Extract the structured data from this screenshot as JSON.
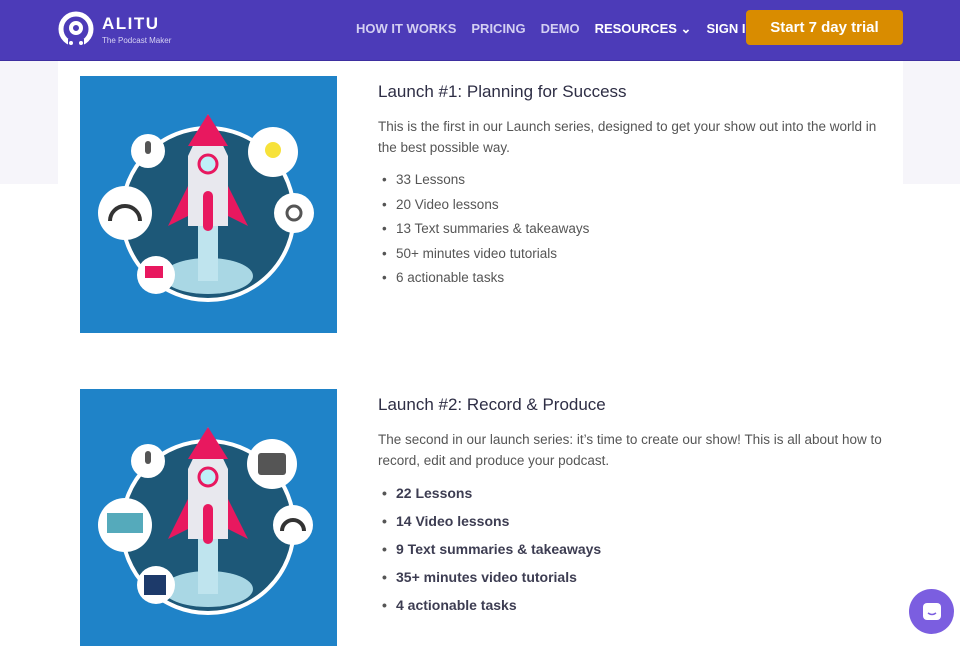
{
  "header": {
    "brand": "ALITU",
    "tagline": "The Podcast Maker",
    "nav": [
      "HOW IT WORKS",
      "PRICING",
      "DEMO",
      "RESOURCES",
      "SIGN IN"
    ],
    "cta": "Start 7 day trial"
  },
  "courses": [
    {
      "title": "Launch #1: Planning for Success",
      "description": "This is the first in our Launch series, designed to get your show out into the world in the best possible way.",
      "items": [
        "33 Lessons",
        "20 Video lessons",
        "13 Text summaries & takeaways",
        "50+ minutes video tutorials",
        "6 actionable tasks"
      ]
    },
    {
      "title": "Launch #2: Record & Produce",
      "description": "The second in our launch series: it’s time to create our show! This is all about how to record, edit and produce your podcast.",
      "items": [
        "22 Lessons",
        "14 Video lessons",
        "9 Text summaries & takeaways",
        "35+ minutes video tutorials",
        "4 actionable tasks"
      ]
    }
  ],
  "colors": {
    "header": "#4c3bb8",
    "cta": "#d98c00",
    "image_bg": "#1f83c8",
    "rocket": "#e8185f"
  }
}
